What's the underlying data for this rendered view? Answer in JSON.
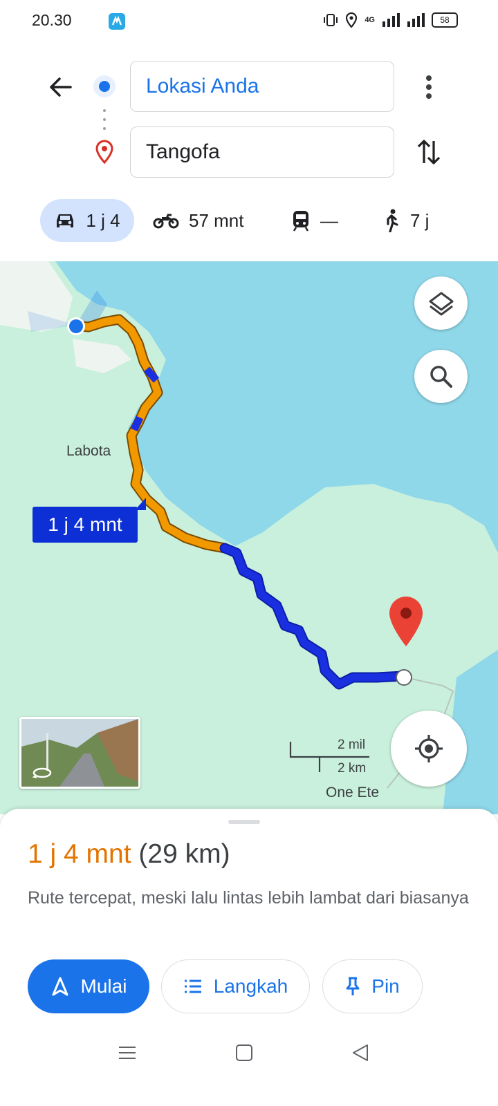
{
  "status_bar": {
    "time": "20.30",
    "network": "4G",
    "battery": "58"
  },
  "search": {
    "origin": "Lokasi Anda",
    "destination": "Tangofa"
  },
  "modes": [
    {
      "name": "car",
      "label": "1 j 4",
      "selected": true
    },
    {
      "name": "motorcycle",
      "label": "57 mnt"
    },
    {
      "name": "transit",
      "label": "—"
    },
    {
      "name": "walk",
      "label": "7 j"
    }
  ],
  "map": {
    "eta_label": "1 j 4 mnt",
    "places": [
      "Labota",
      "One Ete"
    ],
    "scale": {
      "imperial": "2 mil",
      "metric": "2 km"
    },
    "route_colors": {
      "slow": "#f29900",
      "normal": "#1a2fe0"
    },
    "water_color": "#8fd8ea",
    "land_color": "#c9f0dc"
  },
  "summary": {
    "duration": "1 j 4 mnt",
    "distance": "(29 km)",
    "note": "Rute tercepat, meski lalu lintas lebih lambat dari biasanya"
  },
  "actions": {
    "start": "Mulai",
    "steps": "Langkah",
    "pin": "Pin"
  },
  "accent": "#1a73e8"
}
